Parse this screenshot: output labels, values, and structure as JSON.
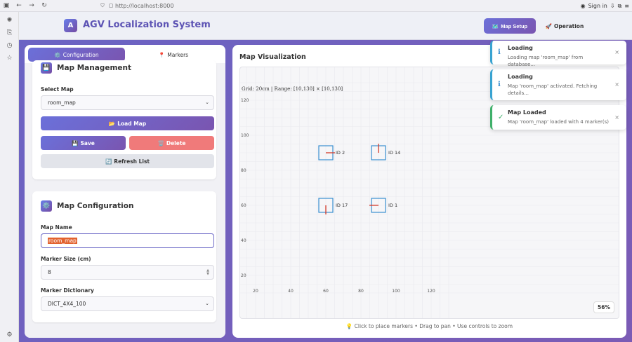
{
  "browser": {
    "url": "http://localhost:8000",
    "sign_in": "Sign in"
  },
  "app": {
    "logo_letter": "A",
    "title": "AGV Localization System",
    "nav": {
      "map_setup": "Map Setup",
      "map_setup_icon": "🗺️",
      "operation": "Operation",
      "operation_icon": "🚀"
    }
  },
  "left_panel": {
    "tabs": [
      {
        "icon": "⚙️",
        "label": "Configuration"
      },
      {
        "icon": "📍",
        "label": "Markers"
      }
    ],
    "map_management": {
      "icon": "💾",
      "title": "Map Management",
      "select_label": "Select Map",
      "selected_map": "room_map",
      "load_button": "Load Map",
      "load_icon": "📂",
      "save_button": "Save",
      "save_icon": "💾",
      "delete_button": "Delete",
      "delete_icon": "🗑️",
      "refresh_button": "Refresh List",
      "refresh_icon": "🔄"
    },
    "map_configuration": {
      "icon": "⚙️",
      "title": "Map Configuration",
      "name_label": "Map Name",
      "name_value": "room_map",
      "size_label": "Marker Size (cm)",
      "size_value": "8",
      "dict_label": "Marker Dictionary",
      "dict_value": "DICT_4X4_100"
    }
  },
  "map_panel": {
    "title": "Map Visualization",
    "zoom": "56%",
    "hint": "💡 Click to place markers • Drag to pan • Use controls to zoom"
  },
  "chart_data": {
    "type": "scatter",
    "info_text": "Grid: 20cm | Range: [10,130] × [10,130]",
    "x_ticks": [
      "20",
      "40",
      "60",
      "80",
      "100",
      "120"
    ],
    "y_ticks": [
      "120",
      "100",
      "80",
      "60",
      "40",
      "20"
    ],
    "xlim": [
      10,
      130
    ],
    "ylim": [
      10,
      130
    ],
    "grid": true,
    "markers": [
      {
        "id": 2,
        "label": "ID 2",
        "x": 60,
        "y": 90,
        "orientation": "right"
      },
      {
        "id": 14,
        "label": "ID 14",
        "x": 90,
        "y": 90,
        "orientation": "up"
      },
      {
        "id": 17,
        "label": "ID 17",
        "x": 60,
        "y": 60,
        "orientation": "down"
      },
      {
        "id": 1,
        "label": "ID 1",
        "x": 90,
        "y": 60,
        "orientation": "left"
      }
    ],
    "marker_color": "#3a8fd0",
    "arrow_color": "#d23a2a"
  },
  "toasts": [
    {
      "type": "info",
      "icon": "ℹ",
      "title": "Loading",
      "message": "Loading map 'room_map' from database..."
    },
    {
      "type": "info",
      "icon": "ℹ",
      "title": "Loading",
      "message": "Map 'room_map' activated. Fetching details..."
    },
    {
      "type": "ok",
      "icon": "✓",
      "title": "Map Loaded",
      "message": "Map 'room_map' loaded with 4 marker(s)"
    }
  ]
}
